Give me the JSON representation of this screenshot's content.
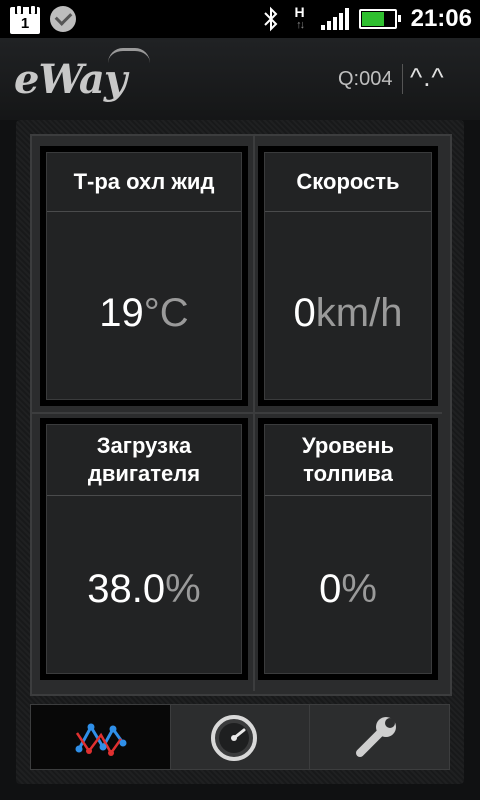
{
  "status_bar": {
    "calendar_day": "1",
    "network_type": "H",
    "time": "21:06",
    "battery_level": 0.65,
    "icons": [
      "calendar-icon",
      "shield-check-icon",
      "bluetooth-icon",
      "network-h-icon",
      "signal-icon",
      "battery-icon"
    ]
  },
  "header": {
    "logo": "eWay",
    "query_counter": "Q:004",
    "face": "^.^"
  },
  "gauges": [
    {
      "title": "Т-ра охл жид",
      "value": "19",
      "unit": "°C"
    },
    {
      "title": "Скорость",
      "value": "0",
      "unit": "km/h"
    },
    {
      "title": "Загрузка двигателя",
      "value": "38.0",
      "unit": "%"
    },
    {
      "title": "Уровень толпива",
      "value": "0",
      "unit": "%"
    }
  ],
  "nav": {
    "tabs": [
      {
        "icon": "graph-icon",
        "active": true
      },
      {
        "icon": "speedometer-icon",
        "active": false
      },
      {
        "icon": "wrench-icon",
        "active": false
      }
    ]
  },
  "colors": {
    "accent_blue": "#2f8fe8",
    "accent_red": "#e03030",
    "battery_green": "#2fbf2f"
  }
}
